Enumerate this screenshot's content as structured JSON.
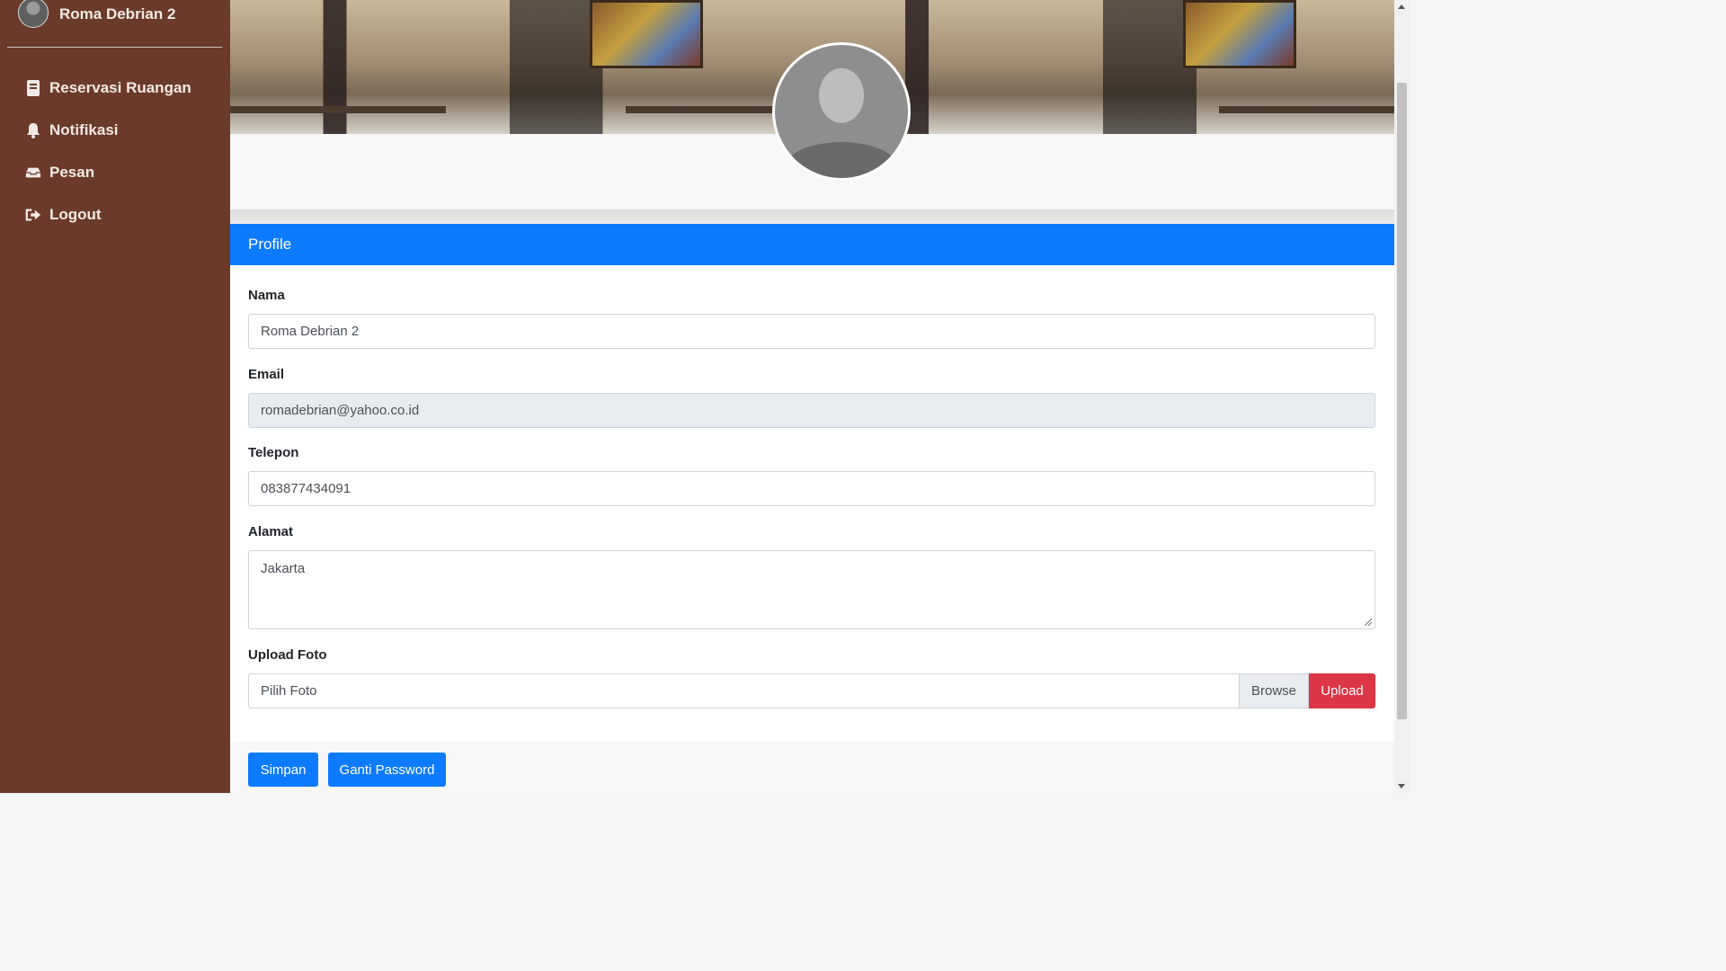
{
  "sidebar": {
    "user_name": "Roma Debrian 2",
    "items": [
      {
        "label": "Reservasi Ruangan",
        "icon": "book-icon"
      },
      {
        "label": "Notifikasi",
        "icon": "bell-icon"
      },
      {
        "label": "Pesan",
        "icon": "inbox-icon"
      },
      {
        "label": "Logout",
        "icon": "sign-out-icon"
      }
    ]
  },
  "profile": {
    "header": "Profile",
    "fields": {
      "nama": {
        "label": "Nama",
        "value": "Roma Debrian 2"
      },
      "email": {
        "label": "Email",
        "value": "romadebrian@yahoo.co.id"
      },
      "telepon": {
        "label": "Telepon",
        "value": "083877434091"
      },
      "alamat": {
        "label": "Alamat",
        "value": "Jakarta"
      },
      "upload": {
        "label": "Upload Foto",
        "placeholder": "Pilih Foto",
        "browse": "Browse",
        "upload_button": "Upload"
      }
    },
    "buttons": {
      "save": "Simpan",
      "change_password": "Ganti Password"
    }
  },
  "colors": {
    "sidebar_bg": "#6b3a2b",
    "primary": "#0d7bff",
    "danger": "#dc3545"
  }
}
